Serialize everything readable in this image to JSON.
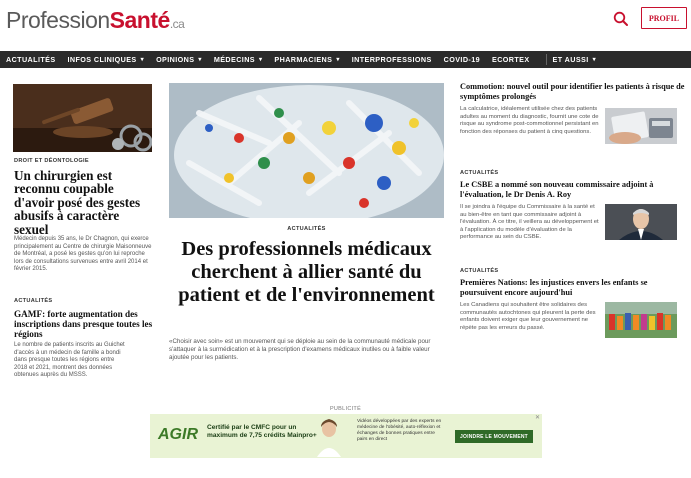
{
  "header": {
    "logo_part1": "Profession",
    "logo_part2": "Santé",
    "logo_part3": ".ca",
    "search_icon": "search-icon",
    "profile_button": "PROFIL",
    "accent_color": "#c8102e"
  },
  "nav": {
    "items": [
      {
        "label": "ACTUALITÉS",
        "dropdown": false
      },
      {
        "label": "INFOS CLINIQUES",
        "dropdown": true
      },
      {
        "label": "OPINIONS",
        "dropdown": true
      },
      {
        "label": "MÉDECINS",
        "dropdown": true
      },
      {
        "label": "PHARMACIENS",
        "dropdown": true
      },
      {
        "label": "INTERPROFESSIONS",
        "dropdown": false
      },
      {
        "label": "COVID-19",
        "dropdown": false
      },
      {
        "label": "ECORTEX",
        "dropdown": false
      },
      {
        "label": "ET AUSSI",
        "dropdown": true
      }
    ]
  },
  "left": {
    "article1": {
      "kicker": "DROIT ET DÉONTOLOGIE",
      "title": "Un chirurgien est reconnu coupable d'avoir posé des gestes abusifs à caractère sexuel",
      "body": "Médecin depuis 35 ans, le Dr Chagnon, qui exerce principalement au Centre de chirurgie Maisonneuve de Montréal, a posé les gestes qu'on lui reproche lors de consultations survenues entre avril 2014 et février 2015."
    },
    "article2": {
      "kicker": "ACTUALITÉS",
      "title": "GAMF: forte augmentation des inscriptions dans presque toutes les régions",
      "body": "Le nombre de patients inscrits au Guichet d'accès à un médecin de famille a bondi dans presque toutes les régions entre 2018 et 2021, montrent des données obtenues auprès du MSSS."
    }
  },
  "center": {
    "kicker": "ACTUALITÉS",
    "title": "Des professionnels médicaux cherchent à allier santé du patient et de l'environnement",
    "body": "«Choisir avec soin» est un mouvement qui se déploie au sein de la communauté médicale pour s'attaquer à la surmédication et à la prescription d'examens médicaux inutiles ou à faible valeur ajoutée pour les patients."
  },
  "right": {
    "article1": {
      "title": "Commotion: nouvel outil pour identifier les patients à risque de symptômes prolongés",
      "body": "La calculatrice, idéalement utilisée chez des patients adultes au moment du diagnostic, fournit une cote de risque au syndrome post-commotionnel persistant en fonction des réponses du patient à cinq questions."
    },
    "article2": {
      "kicker": "ACTUALITÉS",
      "title": "Le CSBE a nommé son nouveau commissaire adjoint à l'évaluation, le Dr Denis A. Roy",
      "body": "Il se joindra à l'équipe du Commissaire à la santé et au bien-être en tant que commissaire adjoint à l'évaluation. À ce titre, il veillera au développement et à l'application du modèle d'évaluation de la performance au sein du CSBE."
    },
    "article3": {
      "kicker": "ACTUALITÉS",
      "title": "Premières Nations: les injustices envers les enfants se poursuivent encore aujourd'hui",
      "body": "Les Canadiens qui souhaitent être solidaires des communautés autochtones qui pleurent la perte des enfants doivent exiger que leur gouvernement ne répète pas les erreurs du passé."
    }
  },
  "ad": {
    "label": "PUBLICITÉ",
    "logo": "AGIR",
    "headline": "Certifié par le CMFC pour un maximum de 7,75 crédits Mainpro+",
    "description": "Vidéos développées par des experts en médecine de l'obésité, auto-réflexion et échanges de bonnes pratiques entre pairs en direct",
    "button": "JOINDRE LE MOUVEMENT",
    "close": "✕"
  }
}
